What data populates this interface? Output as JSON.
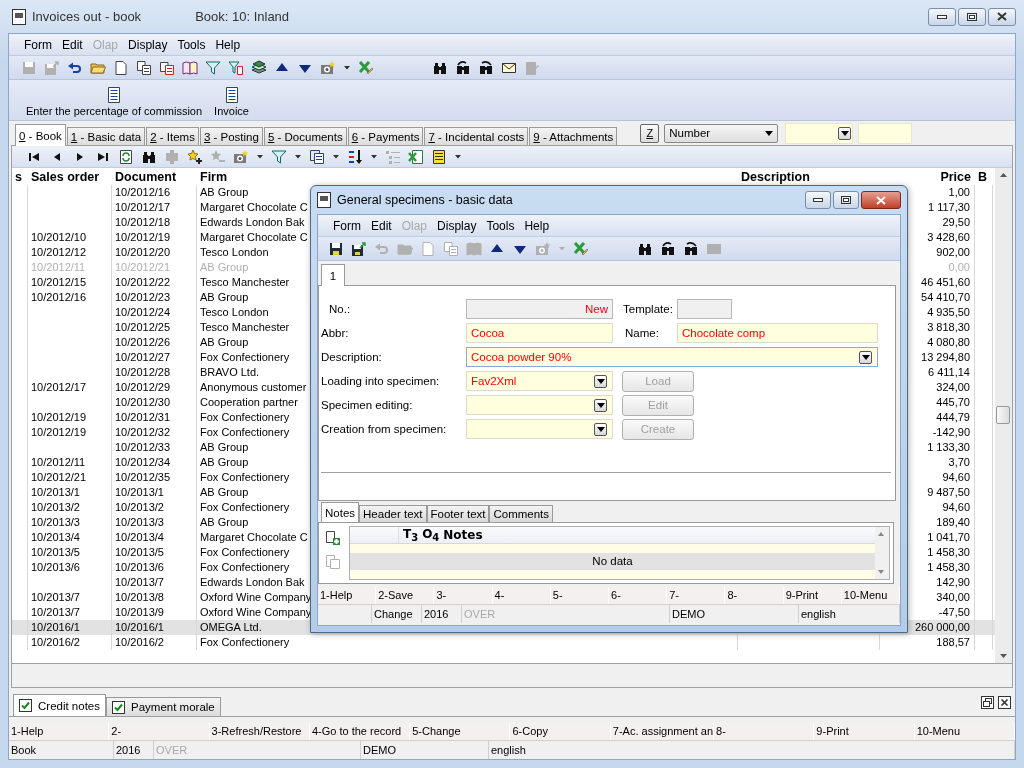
{
  "window": {
    "title": "Invoices out - book",
    "subtitle": "Book: 10: Inland"
  },
  "menu": [
    {
      "label": "Form",
      "disabled": false
    },
    {
      "label": "Edit",
      "disabled": false
    },
    {
      "label": "Olap",
      "disabled": true
    },
    {
      "label": "Display",
      "disabled": false
    },
    {
      "label": "Tools",
      "disabled": false
    },
    {
      "label": "Help",
      "disabled": false
    }
  ],
  "toolbar": [
    [
      {
        "kind": "save",
        "disabled": true
      },
      {
        "kind": "save-as",
        "disabled": true
      },
      {
        "kind": "undo",
        "disabled": false
      },
      {
        "kind": "folder",
        "disabled": false
      },
      {
        "kind": "page",
        "disabled": false
      },
      {
        "kind": "copy",
        "disabled": false
      },
      {
        "kind": "paste",
        "disabled": false
      },
      {
        "kind": "book",
        "disabled": false
      },
      {
        "kind": "filter",
        "disabled": false
      },
      {
        "kind": "filter-doc",
        "disabled": false
      },
      {
        "kind": "stack",
        "disabled": false
      },
      {
        "kind": "up",
        "disabled": false
      },
      {
        "kind": "down",
        "disabled": false
      },
      {
        "kind": "camera",
        "disabled": false
      },
      {
        "kind": "caret",
        "disabled": false
      },
      {
        "kind": "export",
        "disabled": false
      }
    ],
    [
      {
        "kind": "find",
        "disabled": false
      },
      {
        "kind": "find-prev",
        "disabled": false
      },
      {
        "kind": "find-next",
        "disabled": false
      },
      {
        "kind": "mail",
        "disabled": false
      },
      {
        "kind": "edit-doc",
        "disabled": true
      }
    ]
  ],
  "actions": [
    "Enter the percentage of commission",
    "Invoice"
  ],
  "tabs": [
    {
      "label": "0 - Book",
      "selected": true
    },
    {
      "label": "1 - Basic data",
      "selected": false
    },
    {
      "label": "2 - Items",
      "selected": false
    },
    {
      "label": "3 - Posting",
      "selected": false
    },
    {
      "label": "5 - Documents",
      "selected": false
    },
    {
      "label": "6 - Payments",
      "selected": false
    },
    {
      "label": "7 - Incidental costs",
      "selected": false
    },
    {
      "label": "9 - Attachments",
      "selected": false
    }
  ],
  "order_controls": {
    "z_button": "Z",
    "order_by": "Number"
  },
  "nav_toolbar": [
    {
      "kind": "first",
      "disabled": false
    },
    {
      "kind": "prev",
      "disabled": false
    },
    {
      "kind": "next",
      "disabled": false
    },
    {
      "kind": "last",
      "disabled": false
    },
    {
      "kind": "refresh",
      "disabled": false
    },
    {
      "kind": "find",
      "disabled": false
    },
    {
      "kind": "tool",
      "disabled": true
    },
    {
      "kind": "add",
      "disabled": false
    },
    {
      "kind": "remove",
      "disabled": true
    },
    {
      "kind": "camera",
      "disabled": false
    },
    {
      "kind": "caret",
      "disabled": false
    },
    {
      "kind": "filter",
      "disabled": false
    },
    {
      "kind": "caret",
      "disabled": false
    },
    {
      "kind": "report",
      "disabled": false
    },
    {
      "kind": "caret",
      "disabled": false
    },
    {
      "kind": "sort",
      "disabled": false
    },
    {
      "kind": "caret",
      "disabled": false
    },
    {
      "kind": "tree",
      "disabled": true
    },
    {
      "kind": "export-sheet",
      "disabled": false
    },
    {
      "kind": "sheet",
      "disabled": false
    },
    {
      "kind": "caret",
      "disabled": false
    }
  ],
  "table": {
    "columns": [
      "s",
      "Sales order",
      "Document",
      "Firm",
      "Description",
      "Price",
      "B"
    ],
    "rows": [
      {
        "document": "10/2012/16",
        "firm": "AB Group",
        "price": "1,00",
        "cancelled": false,
        "selected": false
      },
      {
        "document": "10/2012/17",
        "firm": "Margaret Chocolate C",
        "price": "1 117,30",
        "cancelled": false,
        "selected": false
      },
      {
        "document": "10/2012/18",
        "firm": "Edwards London Bak",
        "price": "29,50",
        "cancelled": false,
        "selected": false
      },
      {
        "sales_order": "10/2012/10",
        "document": "10/2012/19",
        "firm": "Margaret Chocolate C",
        "price": "3 428,60",
        "cancelled": false,
        "selected": false
      },
      {
        "sales_order": "10/2012/12",
        "document": "10/2012/20",
        "firm": "Tesco London",
        "price": "902,00",
        "cancelled": false,
        "selected": false
      },
      {
        "sales_order": "10/2012/11",
        "document": "10/2012/21",
        "firm": "AB Group",
        "price": "0,00",
        "cancelled": true,
        "selected": false
      },
      {
        "sales_order": "10/2012/15",
        "document": "10/2012/22",
        "firm": "Tesco Manchester",
        "price": "46 451,60",
        "cancelled": false,
        "selected": false
      },
      {
        "sales_order": "10/2012/16",
        "document": "10/2012/23",
        "firm": "AB Group",
        "price": "54 410,70",
        "cancelled": false,
        "selected": false
      },
      {
        "document": "10/2012/24",
        "firm": "Tesco London",
        "price": "4 935,50",
        "cancelled": false,
        "selected": false
      },
      {
        "document": "10/2012/25",
        "firm": "Tesco Manchester",
        "price": "3 818,30",
        "cancelled": false,
        "selected": false
      },
      {
        "document": "10/2012/26",
        "firm": "AB Group",
        "price": "4 080,80",
        "cancelled": false,
        "selected": false
      },
      {
        "document": "10/2012/27",
        "firm": "Fox Confectionery",
        "price": "13 294,80",
        "cancelled": false,
        "selected": false
      },
      {
        "document": "10/2012/28",
        "firm": "BRAVO Ltd.",
        "price": "6 411,14",
        "cancelled": false,
        "selected": false
      },
      {
        "sales_order": "10/2012/17",
        "document": "10/2012/29",
        "firm": "Anonymous customer",
        "price": "324,00",
        "cancelled": false,
        "selected": false
      },
      {
        "document": "10/2012/30",
        "firm": "Cooperation partner",
        "price": "445,70",
        "cancelled": false,
        "selected": false
      },
      {
        "sales_order": "10/2012/19",
        "document": "10/2012/31",
        "firm": "Fox Confectionery",
        "price": "444,79",
        "cancelled": false,
        "selected": false
      },
      {
        "sales_order": "10/2012/19",
        "document": "10/2012/32",
        "firm": "Fox Confectionery",
        "price": "-142,90",
        "cancelled": false,
        "selected": false
      },
      {
        "document": "10/2012/33",
        "firm": "AB Group",
        "price": "1 133,30",
        "cancelled": false,
        "selected": false
      },
      {
        "sales_order": "10/2012/11",
        "document": "10/2012/34",
        "firm": "AB Group",
        "price": "3,70",
        "cancelled": false,
        "selected": false
      },
      {
        "sales_order": "10/2012/21",
        "document": "10/2012/35",
        "firm": "Fox Confectionery",
        "price": "94,60",
        "cancelled": false,
        "selected": false
      },
      {
        "sales_order": "10/2013/1",
        "document": "10/2013/1",
        "firm": "AB Group",
        "price": "9 487,50",
        "cancelled": false,
        "selected": false
      },
      {
        "sales_order": "10/2013/2",
        "document": "10/2013/2",
        "firm": "Fox Confectionery",
        "price": "94,60",
        "cancelled": false,
        "selected": false
      },
      {
        "sales_order": "10/2013/3",
        "document": "10/2013/3",
        "firm": "AB Group",
        "price": "189,40",
        "cancelled": false,
        "selected": false
      },
      {
        "sales_order": "10/2013/4",
        "document": "10/2013/4",
        "firm": "Margaret Chocolate C",
        "price": "1 041,70",
        "cancelled": false,
        "selected": false
      },
      {
        "sales_order": "10/2013/5",
        "document": "10/2013/5",
        "firm": "Fox Confectionery",
        "price": "1 458,30",
        "cancelled": false,
        "selected": false
      },
      {
        "sales_order": "10/2013/6",
        "document": "10/2013/6",
        "firm": "Fox Confectionery",
        "price": "1 458,30",
        "cancelled": false,
        "selected": false
      },
      {
        "document": "10/2013/7",
        "firm": "Edwards London Bak",
        "price": "142,90",
        "cancelled": false,
        "selected": false
      },
      {
        "sales_order": "10/2013/7",
        "document": "10/2013/8",
        "firm": "Oxford Wine Company",
        "price": "340,00",
        "cancelled": false,
        "selected": false
      },
      {
        "sales_order": "10/2013/7",
        "document": "10/2013/9",
        "firm": "Oxford Wine Company",
        "price": "-47,50",
        "cancelled": false,
        "selected": false
      },
      {
        "sales_order": "10/2016/1",
        "document": "10/2016/1",
        "firm": "OMEGA Ltd.",
        "price": "260 000,00",
        "cancelled": false,
        "selected": true
      },
      {
        "sales_order": "10/2016/2",
        "document": "10/2016/2",
        "firm": "Fox Confectionery",
        "price": "188,57",
        "cancelled": false,
        "selected": false
      }
    ]
  },
  "bottom_tabs": [
    {
      "label": "Credit notes",
      "checked": true,
      "selected": true
    },
    {
      "label": "Payment morale",
      "checked": true,
      "selected": false
    }
  ],
  "function_keys": [
    "1-Help",
    "2-",
    "3-Refresh/Restore",
    "4-Go to the record",
    "5-Change",
    "6-Copy",
    "7-Ac. assignment an",
    "8-",
    "9-Print",
    "10-Menu"
  ],
  "status_bar": [
    {
      "text": "Book",
      "disabled": false
    },
    {
      "text": "2016",
      "disabled": false
    },
    {
      "text": "OVER",
      "disabled": true
    },
    {
      "text": "DEMO",
      "disabled": false
    },
    {
      "text": "english",
      "disabled": false
    }
  ],
  "dialog": {
    "title": "General specimens - basic data",
    "menu": [
      {
        "label": "Form",
        "disabled": false
      },
      {
        "label": "Edit",
        "disabled": false
      },
      {
        "label": "Olap",
        "disabled": true
      },
      {
        "label": "Display",
        "disabled": false
      },
      {
        "label": "Tools",
        "disabled": false
      },
      {
        "label": "Help",
        "disabled": false
      }
    ],
    "toolbar": [
      [
        {
          "kind": "save",
          "disabled": false
        },
        {
          "kind": "save-as",
          "disabled": false
        },
        {
          "kind": "undo",
          "disabled": true
        },
        {
          "kind": "folder",
          "disabled": true
        },
        {
          "kind": "page",
          "disabled": true
        },
        {
          "kind": "copy",
          "disabled": true
        },
        {
          "kind": "book",
          "disabled": true
        },
        {
          "kind": "up",
          "disabled": false
        },
        {
          "kind": "down",
          "disabled": false
        },
        {
          "kind": "camera",
          "disabled": true
        },
        {
          "kind": "caret",
          "disabled": true
        },
        {
          "kind": "export",
          "disabled": false
        }
      ],
      [
        {
          "kind": "find",
          "disabled": false
        },
        {
          "kind": "find-prev",
          "disabled": false
        },
        {
          "kind": "find-next",
          "disabled": false
        },
        {
          "kind": "mail",
          "disabled": true
        }
      ]
    ],
    "tabs": [
      {
        "label": "1",
        "selected": true
      }
    ],
    "form": {
      "number": {
        "label": "No.:",
        "value": "New"
      },
      "template": {
        "label": "Template:"
      },
      "abbr": {
        "label": "Abbr:",
        "value": "Cocoa"
      },
      "name": {
        "label": "Name:",
        "value": "Chocolate comp"
      },
      "description": {
        "label": "Description:",
        "value": "Cocoa powder 90%"
      },
      "specimen_rows": [
        {
          "label": "Loading into specimen:",
          "value": "Fav2Xml",
          "button": "Load",
          "button_disabled": true
        },
        {
          "label": "Specimen editing:",
          "button": "Edit",
          "button_disabled": true
        },
        {
          "label": "Creation from specimen:",
          "button": "Create",
          "button_disabled": true
        }
      ]
    },
    "notes": {
      "tabs": [
        {
          "label": "Notes",
          "selected": true
        },
        {
          "label": "Header text",
          "selected": false
        },
        {
          "label": "Footer text",
          "selected": false
        },
        {
          "label": "Comments",
          "selected": false
        }
      ],
      "columns": [
        "T$_{3}$",
        "O$_{4}$",
        "Notes"
      ],
      "empty_text": "No data"
    },
    "function_keys": [
      "1-Help",
      "2-Save",
      "3-",
      "4-",
      "5-",
      "6-",
      "7-",
      "8-",
      "9-Print",
      "10-Menu"
    ],
    "status_bar": [
      {
        "text": "Change",
        "disabled": false
      },
      {
        "text": "2016",
        "disabled": false
      },
      {
        "text": "OVER",
        "disabled": true
      },
      {
        "text": "DEMO",
        "disabled": false
      },
      {
        "text": "english",
        "disabled": false
      }
    ]
  }
}
